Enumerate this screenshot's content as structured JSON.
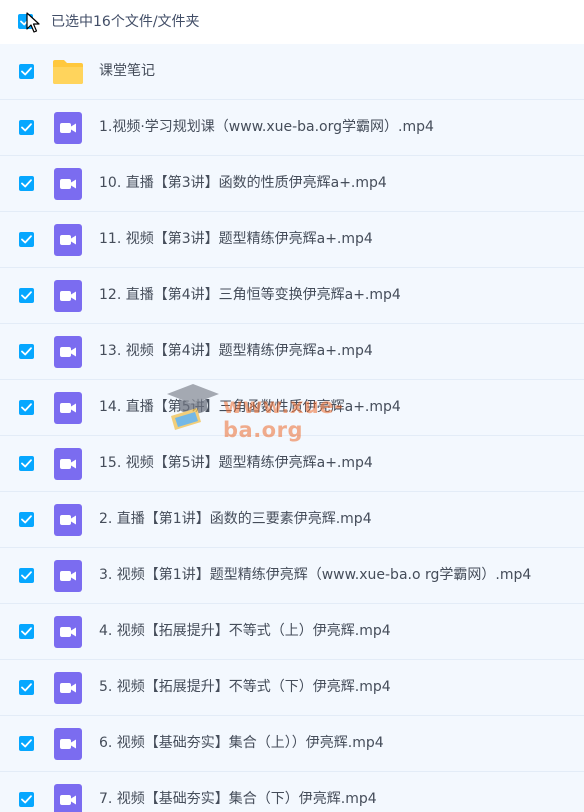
{
  "header": {
    "selection_label": "已选中16个文件/文件夹",
    "select_all_checked": true
  },
  "colors": {
    "checkbox": "#06a7ff",
    "row_background": "#f3f8fe",
    "folder": "#ffc83d",
    "video_icon": "#7b6cf0",
    "text": "#454d5a"
  },
  "files": [
    {
      "name": "课堂笔记",
      "type": "folder",
      "checked": true
    },
    {
      "name": "1.视频·学习规划课（www.xue-ba.org学霸网）.mp4",
      "type": "video",
      "checked": true
    },
    {
      "name": "10. 直播【第3讲】函数的性质伊亮辉a+.mp4",
      "type": "video",
      "checked": true
    },
    {
      "name": "11. 视频【第3讲】题型精练伊亮辉a+.mp4",
      "type": "video",
      "checked": true
    },
    {
      "name": "12. 直播【第4讲】三角恒等变换伊亮辉a+.mp4",
      "type": "video",
      "checked": true
    },
    {
      "name": "13. 视频【第4讲】题型精练伊亮辉a+.mp4",
      "type": "video",
      "checked": true
    },
    {
      "name": "14. 直播【第5讲】三角函数性质伊亮辉a+.mp4",
      "type": "video",
      "checked": true
    },
    {
      "name": "15. 视频【第5讲】题型精练伊亮辉a+.mp4",
      "type": "video",
      "checked": true
    },
    {
      "name": "2. 直播【第1讲】函数的三要素伊亮辉.mp4",
      "type": "video",
      "checked": true
    },
    {
      "name": "3. 视频【第1讲】题型精练伊亮辉（www.xue-ba.o rg学霸网）.mp4",
      "type": "video",
      "checked": true
    },
    {
      "name": "4. 视频【拓展提升】不等式（上）伊亮辉.mp4",
      "type": "video",
      "checked": true
    },
    {
      "name": "5. 视频【拓展提升】不等式（下）伊亮辉.mp4",
      "type": "video",
      "checked": true
    },
    {
      "name": "6. 视频【基础夯实】集合（上））伊亮辉.mp4",
      "type": "video",
      "checked": true
    },
    {
      "name": "7. 视频【基础夯实】集合（下）伊亮辉.mp4",
      "type": "video",
      "checked": true
    }
  ],
  "watermark": {
    "text": "www.xue-ba.org",
    "icon": "graduation-cap-icon"
  }
}
